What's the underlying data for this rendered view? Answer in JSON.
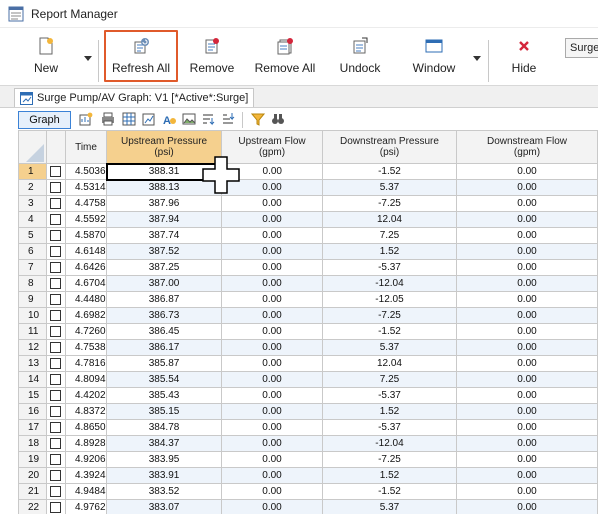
{
  "window": {
    "title": "Report Manager"
  },
  "ribbon": {
    "new": "New",
    "refresh_all": "Refresh All",
    "remove": "Remove",
    "remove_all": "Remove All",
    "undock": "Undock",
    "window": "Window",
    "hide": "Hide",
    "surge_select": "Surge"
  },
  "tab": {
    "label": "Surge Pump/AV Graph: V1 [*Active*:Surge]"
  },
  "toolbar": {
    "graph": "Graph"
  },
  "colors": {
    "highlight_box": "#e05a2b",
    "selected_header": "#f5d08e",
    "alt_row": "#eef4fb",
    "hide_icon": "#d4263b"
  },
  "table": {
    "columns": [
      {
        "name": "Time",
        "unit": ""
      },
      {
        "name": "Upstream Pressure",
        "unit": "(psi)"
      },
      {
        "name": "Upstream Flow",
        "unit": "(gpm)"
      },
      {
        "name": "Downstream Pressure",
        "unit": "(psi)"
      },
      {
        "name": "Downstream Flow",
        "unit": "(gpm)"
      }
    ],
    "rows": [
      {
        "n": "1",
        "time": "4.5036",
        "up": "388.31",
        "upf": "0.00",
        "dp": "-1.52",
        "df": "0.00"
      },
      {
        "n": "2",
        "time": "4.5314",
        "up": "388.13",
        "upf": "0.00",
        "dp": "5.37",
        "df": "0.00"
      },
      {
        "n": "3",
        "time": "4.4758",
        "up": "387.96",
        "upf": "0.00",
        "dp": "-7.25",
        "df": "0.00"
      },
      {
        "n": "4",
        "time": "4.5592",
        "up": "387.94",
        "upf": "0.00",
        "dp": "12.04",
        "df": "0.00"
      },
      {
        "n": "5",
        "time": "4.5870",
        "up": "387.74",
        "upf": "0.00",
        "dp": "7.25",
        "df": "0.00"
      },
      {
        "n": "6",
        "time": "4.6148",
        "up": "387.52",
        "upf": "0.00",
        "dp": "1.52",
        "df": "0.00"
      },
      {
        "n": "7",
        "time": "4.6426",
        "up": "387.25",
        "upf": "0.00",
        "dp": "-5.37",
        "df": "0.00"
      },
      {
        "n": "8",
        "time": "4.6704",
        "up": "387.00",
        "upf": "0.00",
        "dp": "-12.04",
        "df": "0.00"
      },
      {
        "n": "9",
        "time": "4.4480",
        "up": "386.87",
        "upf": "0.00",
        "dp": "-12.05",
        "df": "0.00"
      },
      {
        "n": "10",
        "time": "4.6982",
        "up": "386.73",
        "upf": "0.00",
        "dp": "-7.25",
        "df": "0.00"
      },
      {
        "n": "11",
        "time": "4.7260",
        "up": "386.45",
        "upf": "0.00",
        "dp": "-1.52",
        "df": "0.00"
      },
      {
        "n": "12",
        "time": "4.7538",
        "up": "386.17",
        "upf": "0.00",
        "dp": "5.37",
        "df": "0.00"
      },
      {
        "n": "13",
        "time": "4.7816",
        "up": "385.87",
        "upf": "0.00",
        "dp": "12.04",
        "df": "0.00"
      },
      {
        "n": "14",
        "time": "4.8094",
        "up": "385.54",
        "upf": "0.00",
        "dp": "7.25",
        "df": "0.00"
      },
      {
        "n": "15",
        "time": "4.4202",
        "up": "385.43",
        "upf": "0.00",
        "dp": "-5.37",
        "df": "0.00"
      },
      {
        "n": "16",
        "time": "4.8372",
        "up": "385.15",
        "upf": "0.00",
        "dp": "1.52",
        "df": "0.00"
      },
      {
        "n": "17",
        "time": "4.8650",
        "up": "384.78",
        "upf": "0.00",
        "dp": "-5.37",
        "df": "0.00"
      },
      {
        "n": "18",
        "time": "4.8928",
        "up": "384.37",
        "upf": "0.00",
        "dp": "-12.04",
        "df": "0.00"
      },
      {
        "n": "19",
        "time": "4.9206",
        "up": "383.95",
        "upf": "0.00",
        "dp": "-7.25",
        "df": "0.00"
      },
      {
        "n": "20",
        "time": "4.3924",
        "up": "383.91",
        "upf": "0.00",
        "dp": "1.52",
        "df": "0.00"
      },
      {
        "n": "21",
        "time": "4.9484",
        "up": "383.52",
        "upf": "0.00",
        "dp": "-1.52",
        "df": "0.00"
      },
      {
        "n": "22",
        "time": "4.9762",
        "up": "383.07",
        "upf": "0.00",
        "dp": "5.37",
        "df": "0.00"
      }
    ]
  }
}
